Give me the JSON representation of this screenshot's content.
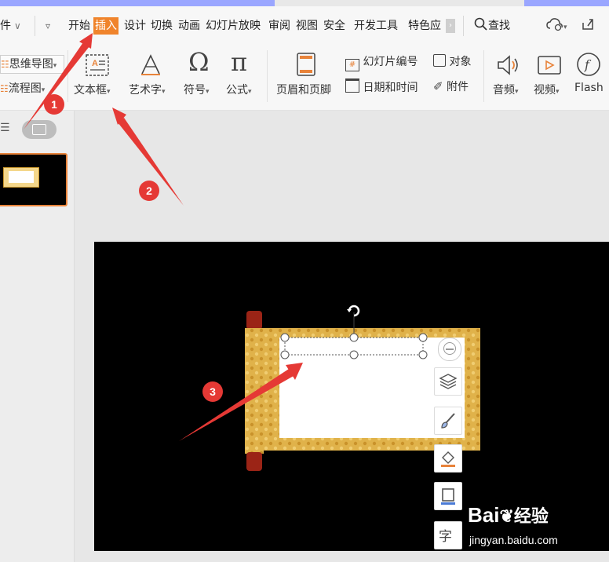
{
  "menubar": {
    "partial_left": "件",
    "items": [
      "开始",
      "插入",
      "设计",
      "切换",
      "动画",
      "幻灯片放映",
      "审阅",
      "视图",
      "安全",
      "开发工具",
      "特色应"
    ],
    "active": "插入",
    "search_label": "查找"
  },
  "ribbon": {
    "mindmap": "思维导图",
    "flowchart": "流程图",
    "textbox": "文本框",
    "wordart": "艺术字",
    "symbol": "符号",
    "formula": "公式",
    "header_footer": "页眉和页脚",
    "slide_number": "幻灯片编号",
    "object": "对象",
    "date_time": "日期和时间",
    "attachment": "附件",
    "audio": "音频",
    "video": "视频",
    "flash": "Flash"
  },
  "annotations": {
    "step1": "1",
    "step2": "2",
    "step3": "3"
  },
  "watermark": {
    "brand": "Bai",
    "brand_cn": "经验",
    "url": "jingyan.baidu.com"
  },
  "colors": {
    "accent": "#f0842c",
    "annotation_red": "#e53935",
    "slide_bg": "#000000",
    "scroll_gold": "#d9a93a"
  }
}
